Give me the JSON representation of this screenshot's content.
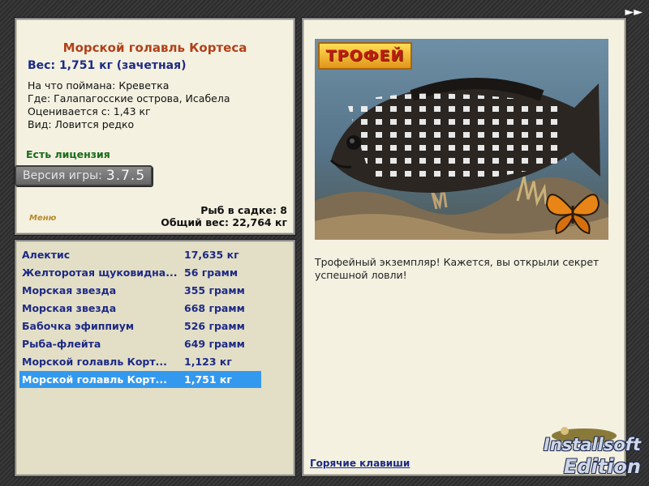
{
  "app": {
    "fast_forward_glyph": "►►",
    "watermark": {
      "line1": "Installsoft",
      "line2": "Edition"
    }
  },
  "info": {
    "title": "Морской голавль Кортеса",
    "weight": "Вес: 1,751 кг (зачетная)",
    "bait": "На что поймана: Креветка",
    "location": "Где: Галапагосские острова, Исабела",
    "value": "Оценивается с: 1,43 кг",
    "rarity": "Вид: Ловится редко",
    "license": "Есть лицензия",
    "version_label": "Версия игры:",
    "version_value": "3.7.5",
    "menu_tag": "Меню",
    "keepnet_count": "Рыб в садке: 8",
    "keepnet_weight": "Общий вес: 22,764 кг"
  },
  "catch_list": [
    {
      "name": "Алектис",
      "weight": "17,635 кг",
      "selected": false
    },
    {
      "name": "Желторотая щуковидна...",
      "weight": "56 грамм",
      "selected": false
    },
    {
      "name": "Морская звезда",
      "weight": "355 грамм",
      "selected": false
    },
    {
      "name": "Морская звезда",
      "weight": "668 грамм",
      "selected": false
    },
    {
      "name": "Бабочка эфиппиум",
      "weight": "526 грамм",
      "selected": false
    },
    {
      "name": "Рыба-флейта",
      "weight": "649 грамм",
      "selected": false
    },
    {
      "name": "Морской голавль Корт...",
      "weight": "1,123 кг",
      "selected": false
    },
    {
      "name": "Морской голавль Корт...",
      "weight": "1,751 кг",
      "selected": true
    }
  ],
  "detail": {
    "trophy_badge": "ТРОФЕЙ",
    "description": "Трофейный экземпляр! Кажется, вы открыли секрет успешной ловли!",
    "hotkeys_link": "Горячие клавиши"
  },
  "colors": {
    "selection": "#3399ee",
    "title": "#b0411a",
    "link_blue": "#1d2a86",
    "license_green": "#1a6b1a"
  }
}
